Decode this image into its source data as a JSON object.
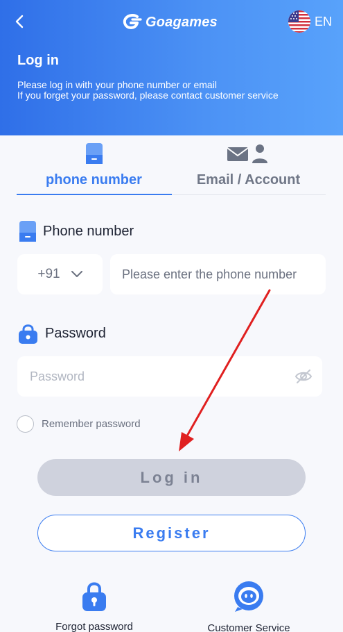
{
  "header": {
    "brand": "Goagames",
    "language": "EN",
    "title": "Log in",
    "subtitle_line1": "Please log in with your phone number or email",
    "subtitle_line2": "If you forget your password, please contact customer service"
  },
  "tabs": [
    {
      "label": "phone number",
      "icon": "phone-icon",
      "active": true
    },
    {
      "label": "Email / Account",
      "icon": "email-account-icon",
      "active": false
    }
  ],
  "phone": {
    "label": "Phone number",
    "country_code": "+91",
    "placeholder": "Please enter the phone number",
    "value": ""
  },
  "password": {
    "label": "Password",
    "placeholder": "Password",
    "value": ""
  },
  "remember": {
    "label": "Remember password",
    "checked": false
  },
  "buttons": {
    "login": "Log in",
    "register": "Register"
  },
  "bottom": {
    "forgot": "Forgot password",
    "customer_service": "Customer Service"
  },
  "colors": {
    "accent": "#3a7cf0",
    "header_gradient_start": "#2f6fe8",
    "header_gradient_end": "#58a2fb",
    "annotation_arrow": "#e02020"
  }
}
